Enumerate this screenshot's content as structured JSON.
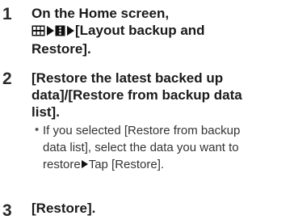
{
  "steps": [
    {
      "number": "1",
      "line1": "On the Home screen,",
      "icon_apps": "apps-grid-icon",
      "icon_menu": "menu-icon",
      "line2_text": "[Layout backup and",
      "line3": "Restore]."
    },
    {
      "number": "2",
      "line1": "[Restore the latest backed up",
      "line2": "data]/[Restore from backup data",
      "line3": "list].",
      "bullet": "•",
      "note_line1": "If you selected [Restore from backup",
      "note_line2": "data list], select the data you want to",
      "note_line3_a": "restore",
      "note_line3_b": "Tap [Restore]."
    },
    {
      "number": "3",
      "line1": "[Restore]."
    }
  ]
}
